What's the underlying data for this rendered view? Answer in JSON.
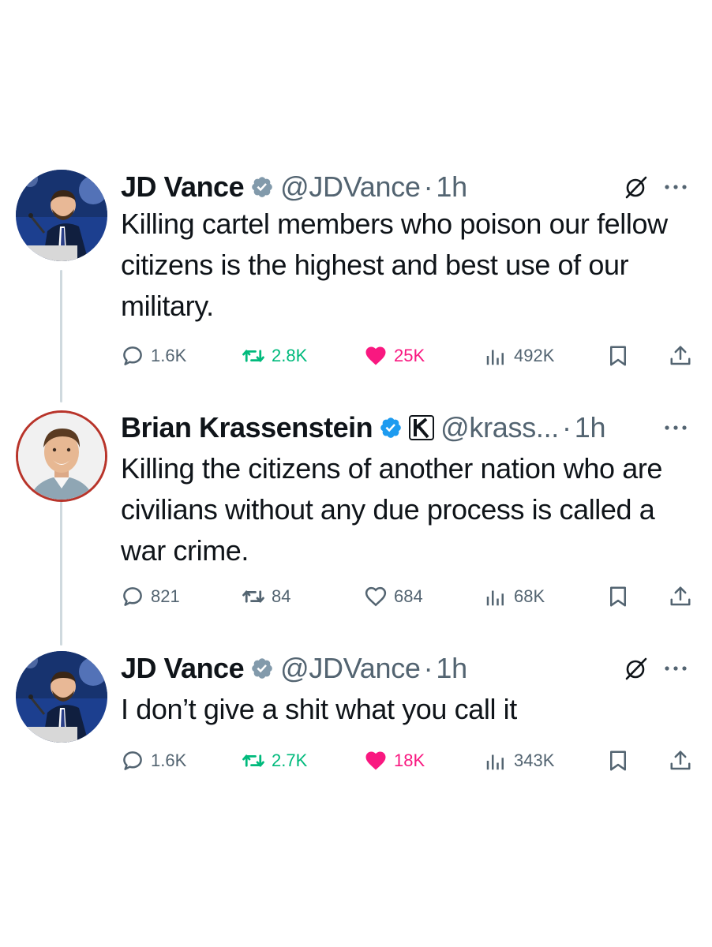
{
  "thread": [
    {
      "author": "JD Vance",
      "handle": "@JDVance",
      "separator": "·",
      "time": "1h",
      "text": "Killing cartel members who poison our fellow citizens is the highest and best use of our military.",
      "metrics": {
        "replies": "1.6K",
        "retweets": "2.8K",
        "likes": "25K",
        "views": "492K"
      },
      "retweeted": true,
      "liked": true
    },
    {
      "author": "Brian Krassenstein",
      "handle": "@krass...",
      "separator": "·",
      "time": "1h",
      "text": "Killing the citizens of another nation who are civilians without any due process is called a war crime.",
      "metrics": {
        "replies": "821",
        "retweets": "84",
        "likes": "684",
        "views": "68K"
      },
      "retweeted": false,
      "liked": false
    },
    {
      "author": "JD Vance",
      "handle": "@JDVance",
      "separator": "·",
      "time": "1h",
      "text": "I don’t give a shit what you call it",
      "metrics": {
        "replies": "1.6K",
        "retweets": "2.7K",
        "likes": "18K",
        "views": "343K"
      },
      "retweeted": true,
      "liked": true
    }
  ],
  "icons": {
    "reply": "reply-icon",
    "retweet": "retweet-icon",
    "like": "heart-icon",
    "views": "views-icon",
    "bookmark": "bookmark-icon",
    "share": "share-icon",
    "grok": "grok-icon",
    "more": "more-icon",
    "verified": "verified-badge-icon",
    "affiliate": "affiliate-badge-icon"
  },
  "colors": {
    "text": "#0f1419",
    "secondary": "#536471",
    "retweet_active": "#00ba7c",
    "like_active": "#f91880",
    "verified": "#1d9bf0",
    "thread_line": "#cfd9de"
  }
}
